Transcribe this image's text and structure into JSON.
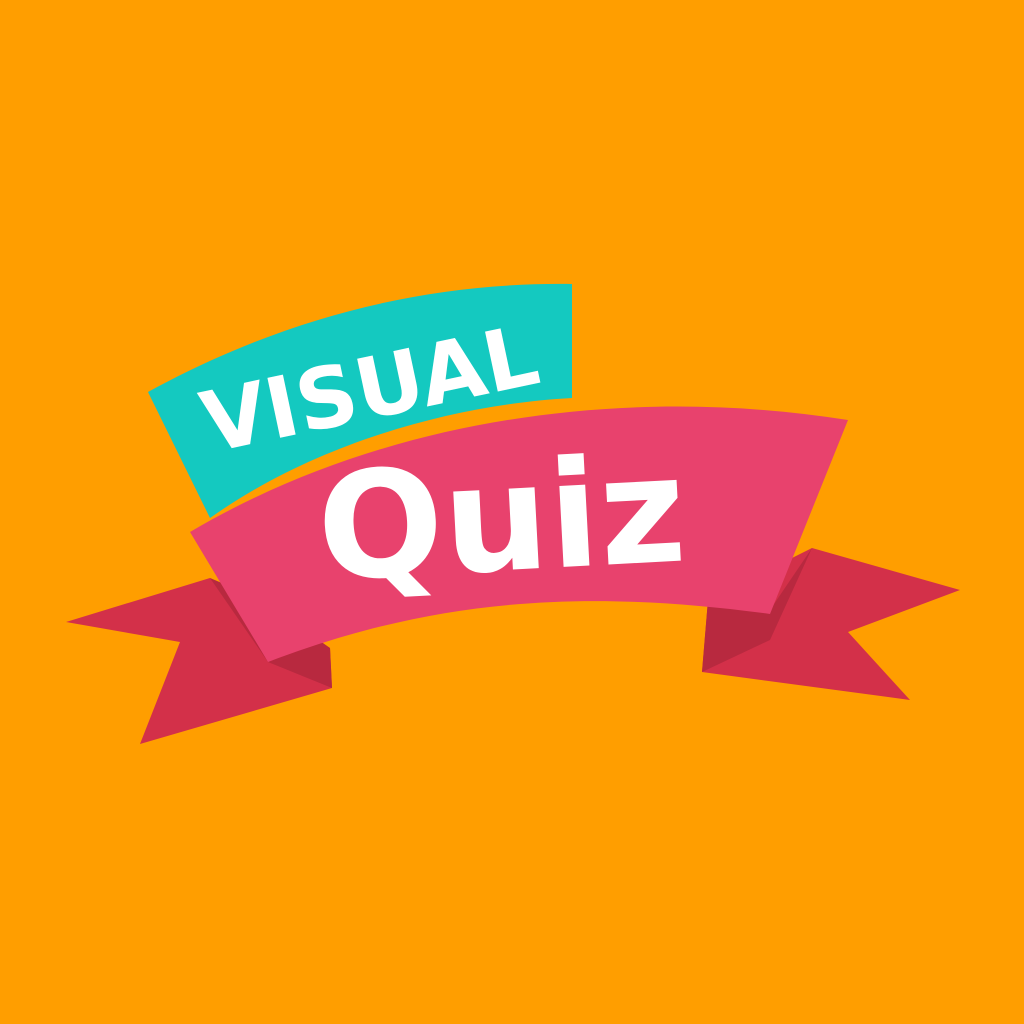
{
  "logo": {
    "top_word": "VISUAL",
    "bottom_word": "Quiz"
  },
  "colors": {
    "background": "#FF9E00",
    "teal_banner": "#14C9C0",
    "pink_banner": "#E8426D",
    "ribbon_tail": "#D33049",
    "ribbon_fold": "#B8293F",
    "text": "#FFFFFF"
  }
}
